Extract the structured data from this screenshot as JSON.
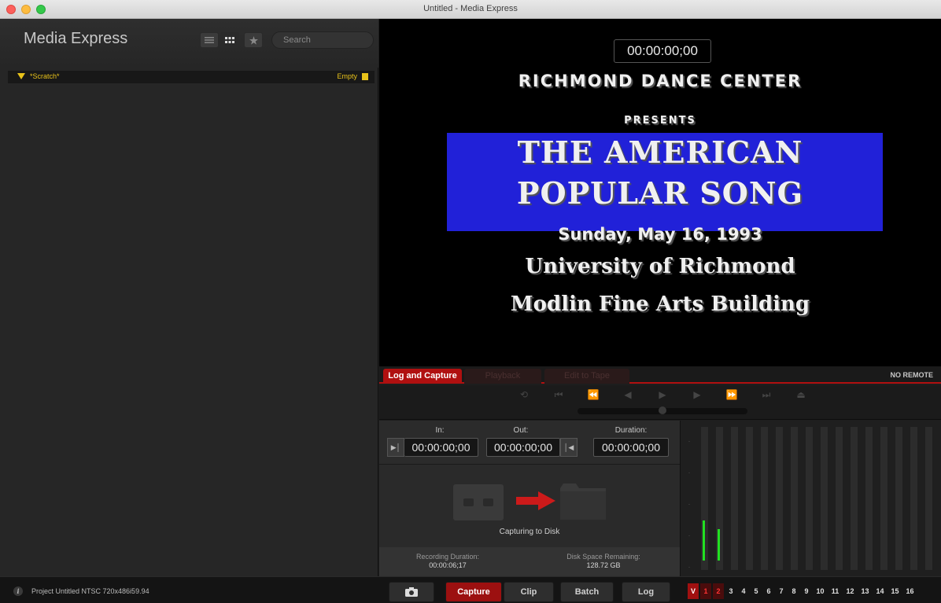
{
  "window": {
    "title": "Untitled - Media Express"
  },
  "sidebar": {
    "app_name": "Media Express",
    "view_buttons": [
      {
        "icon": "list-view-icon"
      },
      {
        "icon": "grid-view-icon"
      },
      {
        "icon": "star-icon"
      }
    ],
    "search_placeholder": "Search",
    "bin": {
      "name": "*Scratch*",
      "status": "Empty",
      "icon": "bin-folder-icon"
    }
  },
  "viewer": {
    "timecode": "00:00:00;00",
    "video_text": {
      "line1": "RICHMOND DANCE CENTER",
      "line2": "PRESENTS",
      "line3": "THE AMERICAN",
      "line4": "POPULAR SONG",
      "line5": "Sunday, May 16, 1993",
      "line6": "University of Richmond",
      "line7": "Modlin Fine Arts Building"
    }
  },
  "tabs": [
    {
      "label": "Log and Capture",
      "active": true
    },
    {
      "label": "Playback",
      "active": false
    },
    {
      "label": "Edit to Tape",
      "active": false
    }
  ],
  "remote_status": "NO REMOTE",
  "transport": {
    "controls": [
      "loop-icon",
      "jump-start-icon",
      "rewind-icon",
      "step-back-icon",
      "play-icon",
      "step-forward-icon",
      "fast-forward-icon",
      "jump-end-icon",
      "eject-icon"
    ],
    "scrub_position": 0.5
  },
  "log": {
    "in_label": "In:",
    "in_value": "00:00:00;00",
    "out_label": "Out:",
    "out_value": "00:00:00;00",
    "duration_label": "Duration:",
    "duration_value": "00:00:00;00"
  },
  "capture_status": "Capturing to Disk",
  "recording": {
    "duration_label": "Recording Duration:",
    "duration_value": "00:00:06;17",
    "disk_label": "Disk Space Remaining:",
    "disk_value": "128.72 GB"
  },
  "meters": {
    "levels": [
      0.28,
      0.22,
      0,
      0,
      0,
      0,
      0,
      0,
      0,
      0,
      0,
      0,
      0,
      0,
      0,
      0
    ],
    "colors": {
      "level": "#22e022"
    }
  },
  "footer": {
    "project_info": "Project Untitled  NTSC 720x486i59.94",
    "buttons": {
      "snapshot_icon": "camera-icon",
      "capture": "Capture",
      "clip": "Clip",
      "batch": "Batch",
      "log": "Log"
    },
    "channels": [
      "V",
      "1",
      "2",
      "3",
      "4",
      "5",
      "6",
      "7",
      "8",
      "9",
      "10",
      "11",
      "12",
      "13",
      "14",
      "15",
      "16"
    ]
  }
}
